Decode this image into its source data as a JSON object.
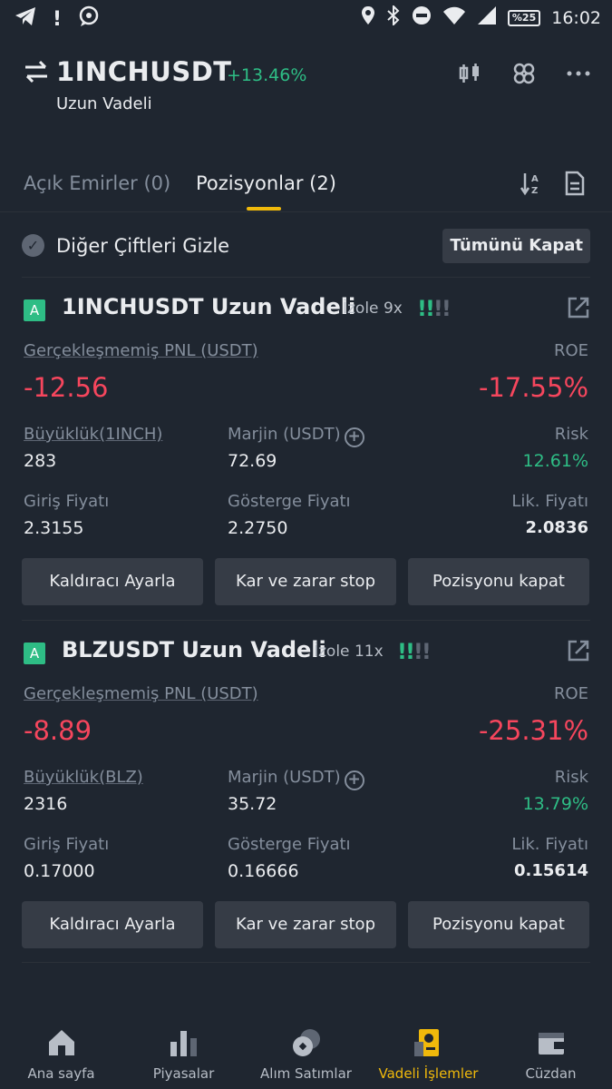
{
  "status_bar": {
    "time": "16:02",
    "battery": "%25",
    "left_icons": [
      "telegram-icon",
      "alert-icon",
      "chat-icon"
    ],
    "right_icons": [
      "location-icon",
      "bluetooth-icon",
      "dnd-icon",
      "wifi-icon",
      "signal-icon",
      "battery-icon"
    ]
  },
  "header": {
    "symbol": "1INCHUSDT",
    "change": "+13.46%",
    "subtitle": "Uzun Vadeli",
    "icons": [
      "candlestick-icon",
      "link-icon",
      "more-icon"
    ]
  },
  "tabs": {
    "open_orders": "Açık Emirler (0)",
    "positions": "Pozisyonlar (2)",
    "tools": [
      "sort-icon",
      "document-icon"
    ]
  },
  "filter": {
    "label": "Diğer Çiftleri Gizle",
    "close_all": "Tümünü Kapat"
  },
  "positions": [
    {
      "side_badge": "A",
      "title": "1INCHUSDT Uzun Vadeli",
      "margin_mode": "İzole",
      "leverage": "9x",
      "pnl_label": "Gerçekleşmemiş PNL (USDT)",
      "pnl": "-12.56",
      "roe_label": "ROE",
      "roe": "-17.55%",
      "size_label": "Büyüklük(1INCH)",
      "size": "283",
      "margin_label": "Marjin (USDT)",
      "margin": "72.69",
      "risk_label": "Risk",
      "risk": "12.61%",
      "entry_label": "Giriş Fiyatı",
      "entry": "2.3155",
      "mark_label": "Gösterge Fiyatı",
      "mark": "2.2750",
      "liq_label": "Lik. Fiyatı",
      "liq": "2.0836",
      "buttons": [
        "Kaldıracı Ayarla",
        "Kar ve zarar stop",
        "Pozisyonu kapat"
      ]
    },
    {
      "side_badge": "A",
      "title": "BLZUSDT Uzun Vadeli",
      "margin_mode": "İzole",
      "leverage": "11x",
      "pnl_label": "Gerçekleşmemiş PNL (USDT)",
      "pnl": "-8.89",
      "roe_label": "ROE",
      "roe": "-25.31%",
      "size_label": "Büyüklük(BLZ)",
      "size": "2316",
      "margin_label": "Marjin (USDT)",
      "margin": "35.72",
      "risk_label": "Risk",
      "risk": "13.79%",
      "entry_label": "Giriş Fiyatı",
      "entry": "0.17000",
      "mark_label": "Gösterge Fiyatı",
      "mark": "0.16666",
      "liq_label": "Lik. Fiyatı",
      "liq": "0.15614",
      "buttons": [
        "Kaldıracı Ayarla",
        "Kar ve zarar stop",
        "Pozisyonu kapat"
      ]
    }
  ],
  "bottom_nav": [
    {
      "label": "Ana sayfa",
      "icon": "home-icon"
    },
    {
      "label": "Piyasalar",
      "icon": "markets-icon"
    },
    {
      "label": "Alım Satımlar",
      "icon": "trade-icon"
    },
    {
      "label": "Vadeli İşlemler",
      "icon": "futures-icon",
      "active": true
    },
    {
      "label": "Cüzdan",
      "icon": "wallet-icon"
    }
  ],
  "colors": {
    "background": "#1f2630",
    "accent": "#f0b90b",
    "positive": "#2ebd85",
    "negative": "#f6465d"
  }
}
